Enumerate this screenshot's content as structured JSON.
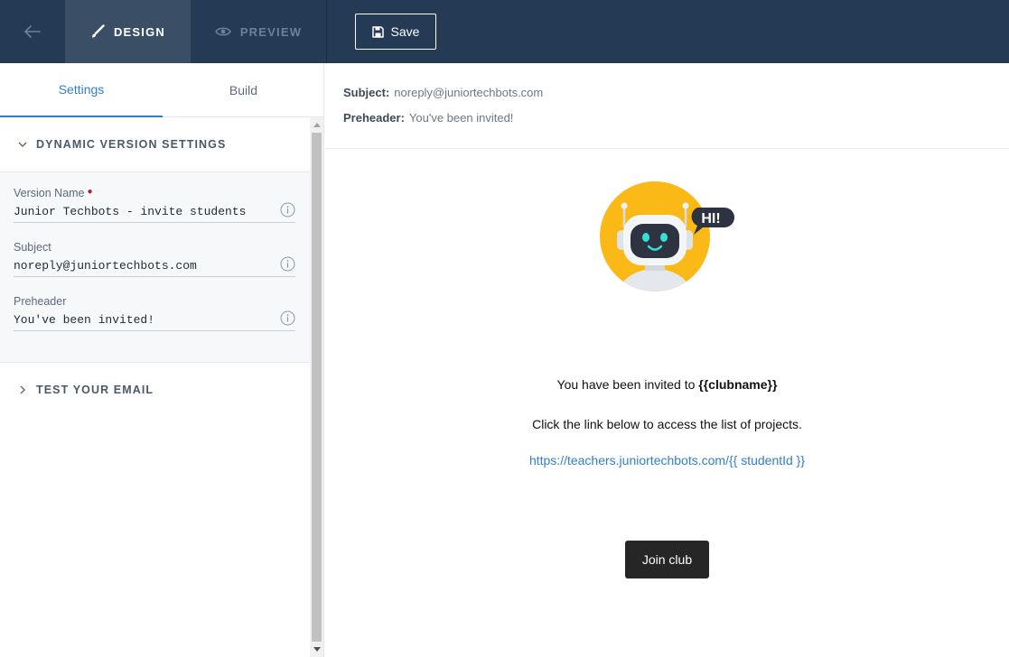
{
  "topbar": {
    "design_label": "DESIGN",
    "preview_label": "PREVIEW",
    "save_label": "Save",
    "active_tab": "design"
  },
  "left_panel": {
    "tabs": [
      {
        "label": "Settings",
        "active": true
      },
      {
        "label": "Build",
        "active": false
      }
    ],
    "dynamic_section": {
      "title": "DYNAMIC VERSION SETTINGS",
      "expanded": true,
      "fields": [
        {
          "label": "Version Name",
          "required": true,
          "value": "Junior Techbots - invite students"
        },
        {
          "label": "Subject",
          "required": false,
          "value": "noreply@juniortechbots.com"
        },
        {
          "label": "Preheader",
          "required": false,
          "value": "You've been invited!"
        }
      ]
    },
    "test_section": {
      "title": "TEST YOUR EMAIL",
      "expanded": false
    }
  },
  "preview": {
    "subject_label": "Subject:",
    "subject_value": "noreply@juniortechbots.com",
    "preheader_label": "Preheader:",
    "preheader_value": "You've been invited!",
    "email": {
      "robot_speech": "HI!",
      "invite_text": "You have been invited to ",
      "invite_var": "{{clubname}}",
      "click_text": "Click the link below to access the list of projects.",
      "link_text": "https://teachers.juniortechbots.com/{{ studentId }}",
      "button_label": "Join club"
    }
  },
  "colors": {
    "topbar_bg": "#243a55",
    "active_tab_bg": "#3a4e66",
    "accent_blue": "#2f7fd1",
    "robot_circle": "#fbb917",
    "button_dark": "#262626",
    "required_dot": "#b21d2a"
  },
  "icons": {
    "back": "arrow-left-icon",
    "design": "paintbrush-icon",
    "preview": "eye-icon",
    "save": "floppy-disk-icon",
    "expand": "chevron-down-icon",
    "collapse": "chevron-right-icon",
    "info": "info-circle-icon"
  }
}
